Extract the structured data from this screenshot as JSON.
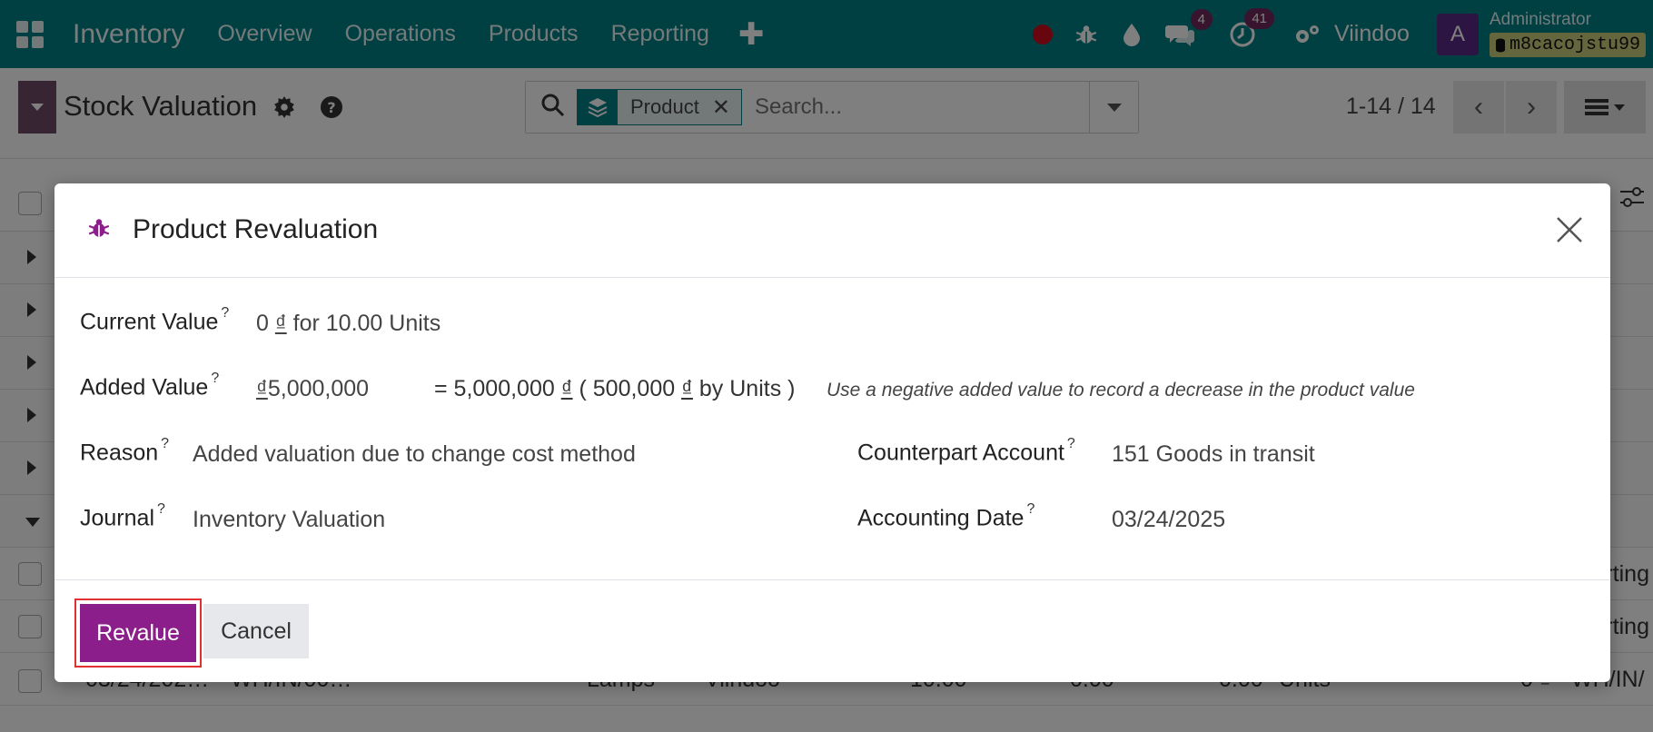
{
  "navbar": {
    "brand": "Inventory",
    "menu": [
      "Overview",
      "Operations",
      "Products",
      "Reporting"
    ],
    "plus": "✚",
    "chat_count": "4",
    "activity_count": "41",
    "company": "Viindoo",
    "avatar_letter": "A",
    "user": "Administrator",
    "database": "m8cacojstu99",
    "color": "#017e84"
  },
  "control": {
    "title": "Stock Valuation",
    "facet_label": "Product",
    "facet_remove": "✕",
    "search_placeholder": "Search...",
    "pager": "1-14 / 14",
    "prev": "‹",
    "next": "›"
  },
  "list": {
    "visible_row": {
      "date": "03/24/202…",
      "reference": "WH/IN/00…",
      "product": "Lamps",
      "company": "Viindoo",
      "quantity": "10.00",
      "unit_value": "0.00",
      "value_col": "0.00",
      "uom": "Units",
      "total": "0 ₫",
      "ref_tail": "WH/IN/"
    },
    "truncated_text": "rting"
  },
  "modal": {
    "title": "Product Revaluation",
    "current_value_label": "Current Value",
    "current_value": "0 ₫ for 10.00 Units",
    "added_value_label": "Added Value",
    "added_value_input": "₫5,000,000",
    "added_value_calc": "= 5,000,000 ₫ ( 500,000 ₫ by Units )",
    "added_value_hint": "Use a negative added value to record a decrease in the product value",
    "reason_label": "Reason",
    "reason_value": "Added valuation due to change cost method",
    "counterpart_label": "Counterpart Account",
    "counterpart_value": "151 Goods in transit",
    "journal_label": "Journal",
    "journal_value": "Inventory Valuation",
    "accounting_date_label": "Accounting Date",
    "accounting_date_value": "03/24/2025",
    "tooltip_mark": "?",
    "revalue_button": "Revalue",
    "cancel_button": "Cancel",
    "accent_color": "#8b1e8a"
  }
}
